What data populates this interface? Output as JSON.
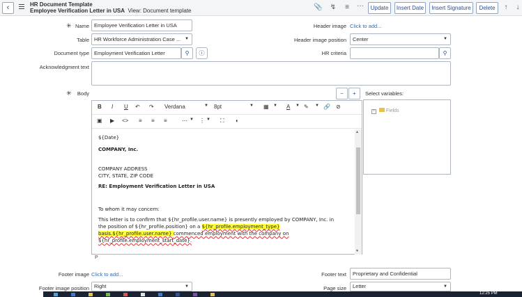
{
  "header": {
    "title": "HR Document Template",
    "record": "Employee Verification Letter in USA",
    "view": "View: Document template",
    "buttons": {
      "update": "Update",
      "insert_date": "Insert Date",
      "insert_signature": "Insert Signature",
      "delete": "Delete"
    },
    "more": "···"
  },
  "form": {
    "name_label": "Name",
    "name_value": "Employee Verification Letter in USA",
    "table_label": "Table",
    "table_value": "HR Workforce Administration Case ...",
    "doctype_label": "Document type",
    "doctype_value": "Employment Verification Letter",
    "ack_label": "Acknowledgment text",
    "body_label": "Body",
    "header_image_label": "Header image",
    "header_image_link": "Click to add...",
    "header_pos_label": "Header image position",
    "header_pos_value": "Center",
    "hr_criteria_label": "HR criteria",
    "select_vars_label": "Select variables:",
    "fields_node": "Fields",
    "footer_image_label": "Footer image",
    "footer_image_link": "Click to add...",
    "footer_pos_label": "Footer image position",
    "footer_pos_value": "Right",
    "footer_text_label": "Footer text",
    "footer_text_value": "Proprietary and Confidential",
    "page_size_label": "Page size",
    "page_size_value": "Letter",
    "req_mark": "✳"
  },
  "editor": {
    "font": "Verdana",
    "size": "8pt",
    "status": "P",
    "lines": {
      "date": "${Date}",
      "company": "COMPANY, Inc.",
      "addr1": "COMPANY ADDRESS",
      "addr2": "CITY, STATE, ZIP CODE",
      "re": "RE: Employment Verification Letter in USA",
      "greet": "To whom it may concern:",
      "p1": "This letter is to confirm that ${hr_profile.user.name} is presently employed by COMPANY, Inc. in",
      "p2a": "the position of ${hr_profile.position} on a ",
      "p2b": "${hr_profile.employment_type}",
      "p3a": "basis.${hr_profile.user.name} ",
      "p3b": "commenced employment with the company on",
      "p4": "${hr_profile.employment_start_date}."
    }
  },
  "taskbar": {
    "time": "12:25 PM"
  }
}
